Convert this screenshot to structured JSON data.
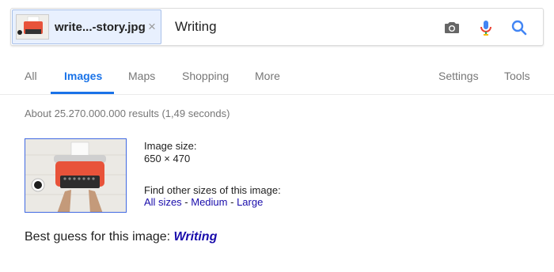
{
  "search": {
    "chip_label": "write...-story.jpg",
    "chip_close": "×",
    "query": "Writing",
    "icons": [
      "camera-icon",
      "mic-icon",
      "search-icon"
    ]
  },
  "tabs": [
    {
      "label": "All",
      "active": false
    },
    {
      "label": "Images",
      "active": true
    },
    {
      "label": "Maps",
      "active": false
    },
    {
      "label": "Shopping",
      "active": false
    },
    {
      "label": "More",
      "active": false
    },
    {
      "label": "Settings",
      "active": false
    },
    {
      "label": "Tools",
      "active": false
    }
  ],
  "results": {
    "count_text": "About 25.270.000.000 results (1,49 seconds)"
  },
  "image_info": {
    "size_label": "Image size:",
    "size_value": "650 × 470",
    "find_label": "Find other sizes of this image:",
    "links": [
      "All sizes",
      "Medium",
      "Large"
    ],
    "separator": " - "
  },
  "best_guess": {
    "label": "Best guess for this image:",
    "value": "Writing"
  },
  "colors": {
    "accent": "#1a73e8",
    "link": "#1a0dab",
    "typewriter": "#e8533a"
  }
}
